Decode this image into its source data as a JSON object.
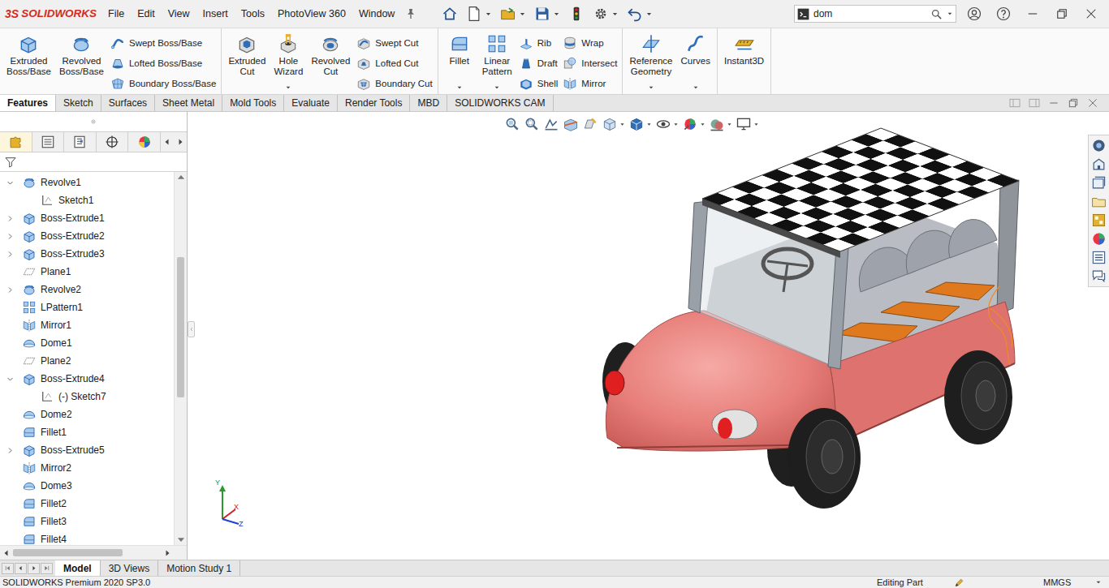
{
  "app": {
    "logo_mark": "3S",
    "logo_text": "SOLIDWORKS"
  },
  "menus": [
    "File",
    "Edit",
    "View",
    "Insert",
    "Tools",
    "PhotoView 360",
    "Window"
  ],
  "search": {
    "value": "dom"
  },
  "ribbon": {
    "sections": [
      {
        "columns": [
          {
            "layout": "large",
            "buttons": [
              {
                "label": "Extruded\nBoss/Base",
                "kind": "extrude",
                "dropdown": false
              }
            ]
          },
          {
            "layout": "large",
            "buttons": [
              {
                "label": "Revolved\nBoss/Base",
                "kind": "revolve",
                "dropdown": false
              }
            ]
          },
          {
            "layout": "stack",
            "buttons": [
              {
                "label": "Swept Boss/Base",
                "kind": "sweep",
                "dropdown": false
              },
              {
                "label": "Lofted Boss/Base",
                "kind": "loft",
                "dropdown": false
              },
              {
                "label": "Boundary Boss/Base",
                "kind": "boundary",
                "dropdown": false
              }
            ]
          }
        ]
      },
      {
        "columns": [
          {
            "layout": "large",
            "buttons": [
              {
                "label": "Extruded\nCut",
                "kind": "extrude-cut",
                "dropdown": false
              }
            ]
          },
          {
            "layout": "large",
            "buttons": [
              {
                "label": "Hole\nWizard",
                "kind": "hole",
                "dropdown": true
              }
            ]
          },
          {
            "layout": "large",
            "buttons": [
              {
                "label": "Revolved\nCut",
                "kind": "revolve-cut",
                "dropdown": false
              }
            ]
          },
          {
            "layout": "stack",
            "buttons": [
              {
                "label": "Swept Cut",
                "kind": "sweep-cut",
                "dropdown": false
              },
              {
                "label": "Lofted Cut",
                "kind": "loft-cut",
                "dropdown": false
              },
              {
                "label": "Boundary Cut",
                "kind": "boundary-cut",
                "dropdown": false
              }
            ]
          }
        ]
      },
      {
        "columns": [
          {
            "layout": "large",
            "buttons": [
              {
                "label": "Fillet",
                "kind": "fillet",
                "dropdown": true
              }
            ]
          },
          {
            "layout": "large",
            "buttons": [
              {
                "label": "Linear\nPattern",
                "kind": "pattern",
                "dropdown": true
              }
            ]
          },
          {
            "layout": "stack",
            "buttons": [
              {
                "label": "Rib",
                "kind": "rib",
                "dropdown": false
              },
              {
                "label": "Draft",
                "kind": "draft",
                "dropdown": false
              },
              {
                "label": "Shell",
                "kind": "shell",
                "dropdown": false
              }
            ]
          },
          {
            "layout": "stack",
            "buttons": [
              {
                "label": "Wrap",
                "kind": "wrap",
                "dropdown": false
              },
              {
                "label": "Intersect",
                "kind": "intersect",
                "dropdown": false
              },
              {
                "label": "Mirror",
                "kind": "mirror",
                "dropdown": false
              }
            ]
          }
        ]
      },
      {
        "columns": [
          {
            "layout": "large",
            "buttons": [
              {
                "label": "Reference\nGeometry",
                "kind": "reference-geometry",
                "dropdown": true
              }
            ]
          },
          {
            "layout": "large",
            "buttons": [
              {
                "label": "Curves",
                "kind": "curves",
                "dropdown": true
              }
            ]
          }
        ]
      },
      {
        "columns": [
          {
            "layout": "large",
            "buttons": [
              {
                "label": "Instant3D",
                "kind": "instant3d",
                "dropdown": false
              }
            ]
          }
        ]
      }
    ]
  },
  "tabs": [
    {
      "label": "Features",
      "selected": true
    },
    {
      "label": "Sketch",
      "selected": false
    },
    {
      "label": "Surfaces",
      "selected": false
    },
    {
      "label": "Sheet Metal",
      "selected": false
    },
    {
      "label": "Mold Tools",
      "selected": false
    },
    {
      "label": "Evaluate",
      "selected": false
    },
    {
      "label": "Render Tools",
      "selected": false
    },
    {
      "label": "MBD",
      "selected": false
    },
    {
      "label": "SOLIDWORKS CAM",
      "selected": false
    }
  ],
  "panel_tabs": [
    {
      "kind": "feature-manager",
      "selected": true
    },
    {
      "kind": "property-manager",
      "selected": false
    },
    {
      "kind": "configuration-manager",
      "selected": false
    },
    {
      "kind": "dimxpert-manager",
      "selected": false
    },
    {
      "kind": "display-manager",
      "selected": false
    }
  ],
  "tree": {
    "items": [
      {
        "label": "Revolve1",
        "kind": "revolve",
        "expandable": true,
        "expanded": true,
        "child": false
      },
      {
        "label": "Sketch1",
        "kind": "sketch",
        "expandable": false,
        "expanded": false,
        "child": true
      },
      {
        "label": "Boss-Extrude1",
        "kind": "extrude",
        "expandable": true,
        "expanded": false,
        "child": false
      },
      {
        "label": "Boss-Extrude2",
        "kind": "extrude",
        "expandable": true,
        "expanded": false,
        "child": false
      },
      {
        "label": "Boss-Extrude3",
        "kind": "extrude",
        "expandable": true,
        "expanded": false,
        "child": false
      },
      {
        "label": "Plane1",
        "kind": "plane",
        "expandable": false,
        "expanded": false,
        "child": false
      },
      {
        "label": "Revolve2",
        "kind": "revolve",
        "expandable": true,
        "expanded": false,
        "child": false
      },
      {
        "label": "LPattern1",
        "kind": "pattern",
        "expandable": false,
        "expanded": false,
        "child": false
      },
      {
        "label": "Mirror1",
        "kind": "mirror",
        "expandable": false,
        "expanded": false,
        "child": false
      },
      {
        "label": "Dome1",
        "kind": "dome",
        "expandable": false,
        "expanded": false,
        "child": false
      },
      {
        "label": "Plane2",
        "kind": "plane",
        "expandable": false,
        "expanded": false,
        "child": false
      },
      {
        "label": "Boss-Extrude4",
        "kind": "extrude",
        "expandable": true,
        "expanded": true,
        "child": false
      },
      {
        "label": "(-) Sketch7",
        "kind": "sketch",
        "expandable": false,
        "expanded": false,
        "child": true
      },
      {
        "label": "Dome2",
        "kind": "dome",
        "expandable": false,
        "expanded": false,
        "child": false
      },
      {
        "label": "Fillet1",
        "kind": "fillet",
        "expandable": false,
        "expanded": false,
        "child": false
      },
      {
        "label": "Boss-Extrude5",
        "kind": "extrude",
        "expandable": true,
        "expanded": false,
        "child": false
      },
      {
        "label": "Mirror2",
        "kind": "mirror",
        "expandable": false,
        "expanded": false,
        "child": false
      },
      {
        "label": "Dome3",
        "kind": "dome",
        "expandable": false,
        "expanded": false,
        "child": false
      },
      {
        "label": "Fillet2",
        "kind": "fillet",
        "expandable": false,
        "expanded": false,
        "child": false
      },
      {
        "label": "Fillet3",
        "kind": "fillet",
        "expandable": false,
        "expanded": false,
        "child": false
      },
      {
        "label": "Fillet4",
        "kind": "fillet",
        "expandable": false,
        "expanded": false,
        "child": false
      }
    ]
  },
  "tree_scrollbars": {
    "vertical": {
      "start": 0.21,
      "size": 0.4
    },
    "horizontal": {
      "start": 0,
      "size": 0.74
    }
  },
  "triad": {
    "x": "X",
    "y": "Y",
    "z": "Z"
  },
  "bottom_tabs": [
    {
      "label": "Model",
      "selected": true
    },
    {
      "label": "3D Views",
      "selected": false
    },
    {
      "label": "Motion Study 1",
      "selected": false
    }
  ],
  "status_bar": {
    "product": "SOLIDWORKS Premium 2020 SP3.0",
    "mode": "Editing Part",
    "units": "MMGS"
  }
}
